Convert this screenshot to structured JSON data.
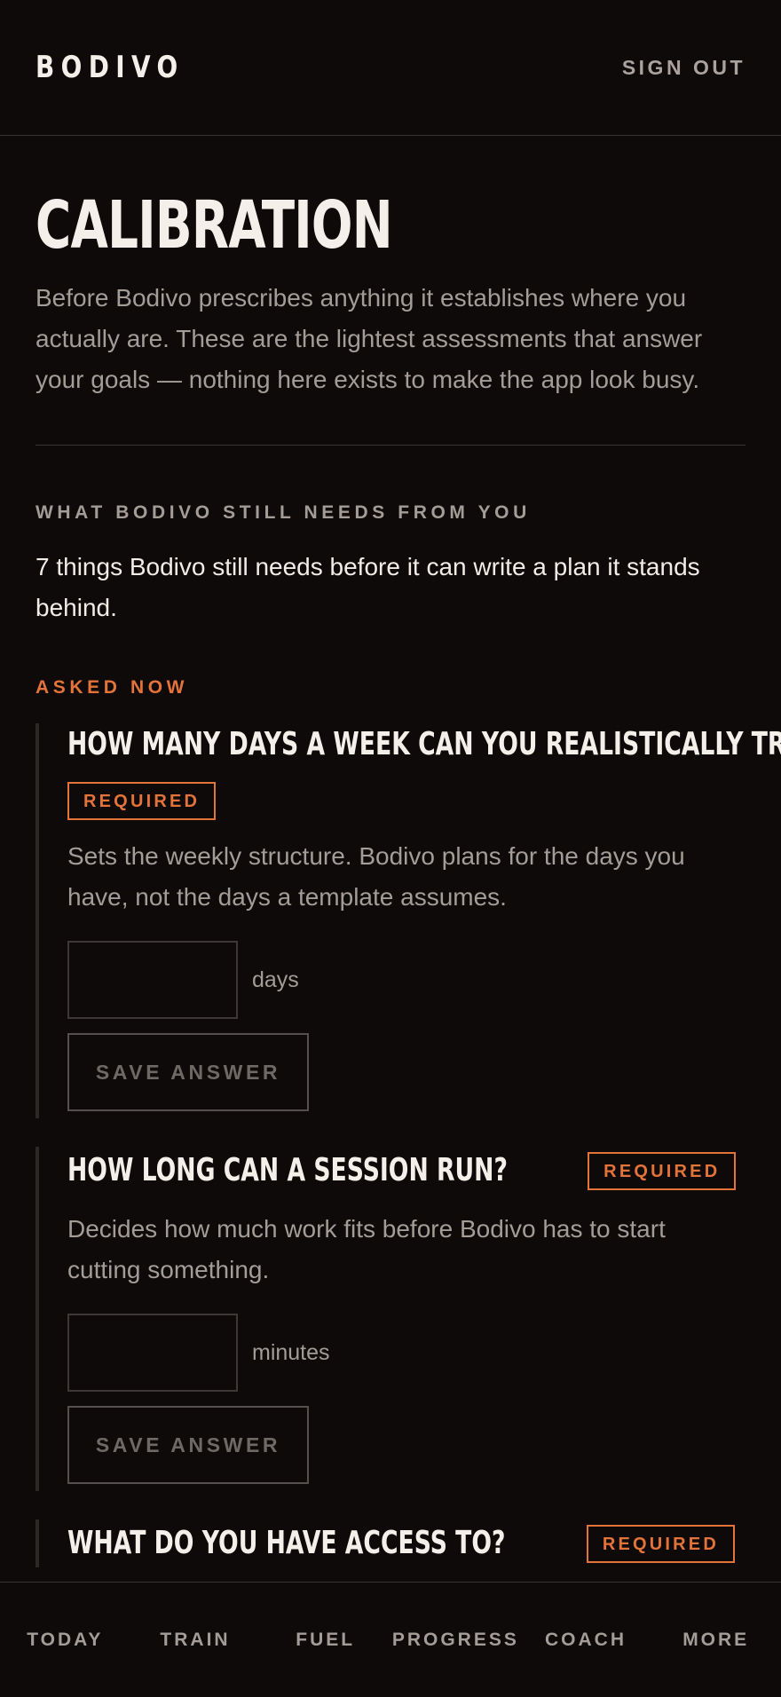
{
  "header": {
    "brand": "BODIVO",
    "sign_out": "SIGN OUT"
  },
  "page": {
    "title": "CALIBRATION",
    "lead": "Before Bodivo prescribes anything it establishes where you actually are. These are the lightest assessments that answer your goals — nothing here exists to make the app look busy."
  },
  "needs": {
    "kicker": "WHAT BODIVO STILL NEEDS FROM YOU",
    "summary": "7 things Bodivo still needs before it can write a plan it stands behind.",
    "asked_now_label": "ASKED NOW"
  },
  "questions": [
    {
      "title": "HOW MANY DAYS A WEEK CAN YOU REALISTICALLY TRAIN?",
      "badge": "REQUIRED",
      "description": "Sets the weekly structure. Bodivo plans for the days you have, not the days a template assumes.",
      "value": "",
      "unit": "days",
      "save_label": "SAVE ANSWER"
    },
    {
      "title": "HOW LONG CAN A SESSION RUN?",
      "badge": "REQUIRED",
      "description": "Decides how much work fits before Bodivo has to start cutting something.",
      "value": "",
      "unit": "minutes",
      "save_label": "SAVE ANSWER"
    },
    {
      "title": "WHAT DO YOU HAVE ACCESS TO?",
      "badge": "REQUIRED"
    }
  ],
  "nav": {
    "items": [
      "TODAY",
      "TRAIN",
      "FUEL",
      "PROGRESS",
      "COACH",
      "MORE"
    ]
  },
  "colors": {
    "background": "#0d0a09",
    "accent": "#e4733a",
    "muted_text": "#a39c97",
    "primary_text": "#f5efe9"
  }
}
